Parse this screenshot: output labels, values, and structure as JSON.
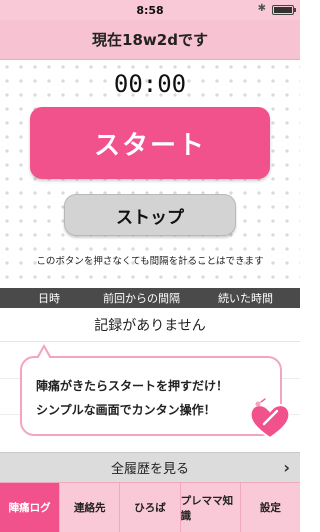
{
  "status_bar": {
    "time": "8:58",
    "bluetooth": "✱"
  },
  "header": {
    "title": "現在18w2dです"
  },
  "timer": {
    "display": "00:00"
  },
  "buttons": {
    "start_label": "スタート",
    "stop_label": "ストップ"
  },
  "note": "このボタンを押さなくても間隔を計ることはできます",
  "table": {
    "columns": [
      "日時",
      "前回からの間隔",
      "続いた時間"
    ],
    "empty_message": "記録がありません"
  },
  "bubble": {
    "line1": "陣痛がきたらスタートを押すだけ！",
    "line2": "シンプルな画面でカンタン操作！"
  },
  "history": {
    "label": "全履歴を見る",
    "chevron": "›"
  },
  "tabs": [
    {
      "label": "陣痛ログ",
      "active": true
    },
    {
      "label": "連絡先",
      "active": false
    },
    {
      "label": "ひろば",
      "active": false
    },
    {
      "label": "プレママ知識",
      "active": false
    },
    {
      "label": "設定",
      "active": false
    }
  ],
  "colors": {
    "accent": "#f2528c",
    "header_pink": "#f7c2d2",
    "bubble_border": "#f4a4bf"
  }
}
